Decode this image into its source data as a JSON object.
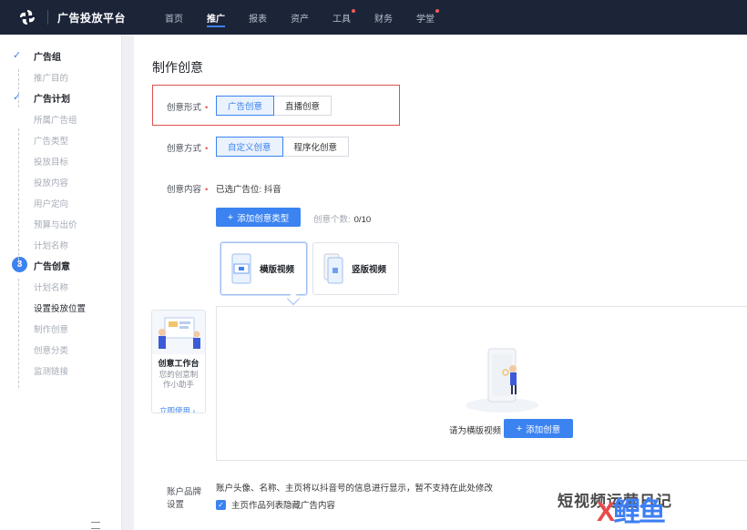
{
  "app": {
    "brand": "广告投放平台"
  },
  "nav": [
    {
      "label": "首页",
      "active": false,
      "dot": false
    },
    {
      "label": "推广",
      "active": true,
      "dot": false
    },
    {
      "label": "报表",
      "active": false,
      "dot": false
    },
    {
      "label": "资产",
      "active": false,
      "dot": false
    },
    {
      "label": "工具",
      "active": false,
      "dot": true
    },
    {
      "label": "财务",
      "active": false,
      "dot": false
    },
    {
      "label": "学堂",
      "active": false,
      "dot": true
    }
  ],
  "sidebar": {
    "group": {
      "title": "广告组",
      "items": [
        "推广目的"
      ]
    },
    "plan": {
      "title": "广告计划",
      "items": [
        "所属广告组",
        "广告类型",
        "投放目标",
        "投放内容",
        "用户定向",
        "预算与出价",
        "计划名称"
      ]
    },
    "creative": {
      "step": "3",
      "title": "广告创意",
      "items": [
        "计划名称",
        "设置投放位置",
        "制作创意",
        "创意分类",
        "监测链接"
      ],
      "current_item": "设置投放位置"
    }
  },
  "main": {
    "title": "制作创意",
    "form_type": {
      "label": "创意形式",
      "options": [
        "广告创意",
        "直播创意"
      ],
      "selected": "广告创意"
    },
    "method": {
      "label": "创意方式",
      "options": [
        "自定义创意",
        "程序化创意"
      ],
      "selected": "自定义创意"
    },
    "content": {
      "label": "创意内容",
      "value": "已选广告位:  抖音"
    },
    "add_type_button": "添加创意类型",
    "count": {
      "label": "创意个数:",
      "value": "0/10"
    },
    "types": [
      {
        "label": "横版视频",
        "active": true
      },
      {
        "label": "竖版视频",
        "active": false
      }
    ],
    "workbench": {
      "title": "创意工作台",
      "desc": "您的创意制作小助手",
      "link": "立即使用 ›"
    },
    "empty": {
      "hint": "请为横版视频",
      "add_button": "添加创意"
    },
    "brand_setting": {
      "label_line1": "账户品牌",
      "label_line2": "设置",
      "note": "账户头像、名称、主页将以抖音号的信息进行显示，暂不支持在此处修改",
      "checkbox_label": "主页作品列表隐藏广告内容",
      "checked": true
    }
  },
  "watermark": {
    "text": "短视频运营日记",
    "logo_part1": "X",
    "logo_part2": "鲤",
    "logo_part3": "鱼"
  },
  "colors": {
    "primary": "#3b83f0",
    "topbar": "#1c2438",
    "highlight": "#d9534f"
  }
}
